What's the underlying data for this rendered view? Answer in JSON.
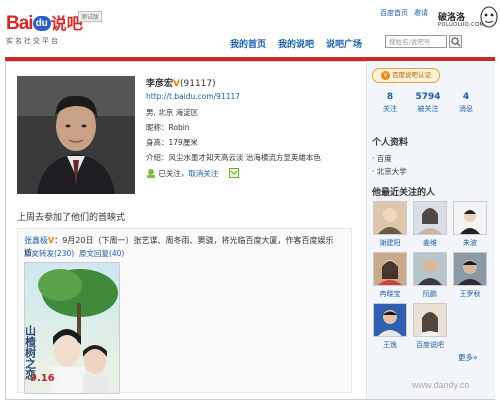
{
  "header": {
    "logo_bai": "Bai",
    "logo_du": "du",
    "logo_shuo": "说吧",
    "logo_sub": "实名社交平台",
    "beta": "测试版",
    "top_links": [
      "百度首页",
      "邀请"
    ],
    "watermark": [
      "破洛洛",
      "POLUOLUO.COM"
    ],
    "nav": [
      "我的首页",
      "我的说吧",
      "说吧广场"
    ],
    "search_placeholder": "搜姓名/说吧号"
  },
  "profile": {
    "name": "李彦宏",
    "v_mark": "V",
    "uid": "(91117)",
    "url": "http://t.baidu.com/91117",
    "gender_loc": "男, 北京 海淀区",
    "nickname": "昵称：Robin",
    "height": "身高：179厘米",
    "intro": "介绍：风尘水墨才知天高云淡 治海横流方显英雄本色",
    "followed": "已关注，",
    "cancel": "取消关注"
  },
  "feed": {
    "title": "上周去参加了他们的首映式",
    "author": "张鑫极",
    "v_mark": "V",
    "text": "：9月20日（下周一）张艺谋、周冬雨、窦骁，将光临百度大厦，作客百度娱乐访。",
    "link_repost": "原文转发(230)",
    "link_reply": "原文回复(40)",
    "poster_title": "山楂树之恋",
    "poster_date": "9.16"
  },
  "sidebar": {
    "cert": "百度说吧认证",
    "stats": [
      {
        "value": "8",
        "label": "关注"
      },
      {
        "value": "5794",
        "label": "被关注"
      },
      {
        "value": "4",
        "label": "消息"
      }
    ],
    "personal_title": "个人资料",
    "personal_items": [
      "百度",
      "北京大学"
    ],
    "follows_title": "他最近关注的人",
    "follows": [
      "谢建阳",
      "姜维",
      "朱波",
      "冉晓宝",
      "阮鹏",
      "王罗秋",
      "王逸",
      "百度说吧"
    ],
    "more": "更多»"
  },
  "footer": {
    "site": "www.dandy.co"
  },
  "colors": {
    "accent": "#c82a2a",
    "link": "#1a5ea8",
    "sidebar_bg": "#f2f6fb"
  }
}
